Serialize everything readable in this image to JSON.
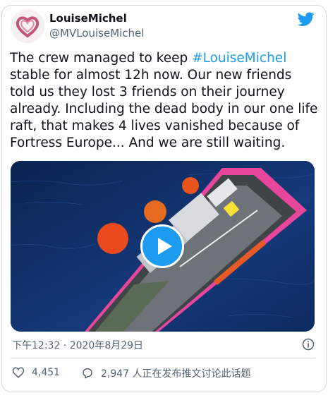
{
  "user": {
    "name": "LouiseMichel",
    "handle": "@MVLouiseMichel",
    "avatar_icon": "heart-logo-icon",
    "avatar_color": "#c2557a"
  },
  "tweet": {
    "text_before": "The crew managed to keep ",
    "hashtag": "#LouiseMichel",
    "text_after": " stable for almost 12h now. Our new friends told us they lost 3 friends on their journey already. Including the dead body in our one life raft, that makes 4 lives vanished because of Fortress Europe... And we are still waiting.",
    "timestamp": "下午12:32 · 2020年8月29日"
  },
  "media": {
    "type": "video",
    "play_icon": "play-icon",
    "ship_color": "#e8469b",
    "sea_color": "#0e2a55"
  },
  "actions": {
    "like_icon": "heart-icon",
    "likes": "4,451",
    "reply_icon": "comment-icon",
    "discussion": "2,947 人正在发布推文讨论此话题"
  },
  "brand": {
    "logo_icon": "twitter-bird-icon",
    "accent": "#1d9bf0"
  }
}
